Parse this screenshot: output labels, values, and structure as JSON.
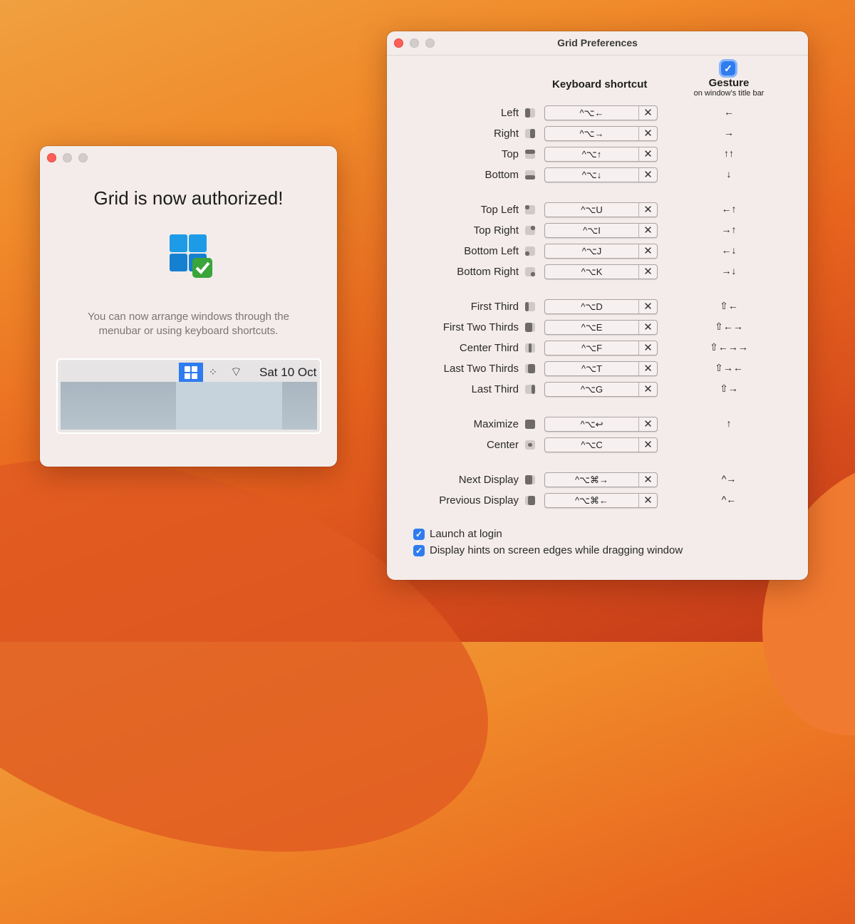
{
  "auth_window": {
    "title": "Grid is now authorized!",
    "description_line1": "You can now arrange windows through the",
    "description_line2": "menubar or using keyboard shortcuts.",
    "menubar": {
      "date": "Sat 10 Oct",
      "wifi_icon": "wifi-icon",
      "grid_icon": "grid-icon"
    }
  },
  "prefs_window": {
    "title": "Grid Preferences",
    "header_keyboard": "Keyboard shortcut",
    "header_gesture": "Gesture",
    "header_gesture_sub": "on window's title bar",
    "gesture_enabled": true,
    "clear_label": "✕",
    "groups": [
      [
        {
          "label": "Left",
          "icon": "left-half",
          "shortcut": "^⌥←",
          "gesture": "←"
        },
        {
          "label": "Right",
          "icon": "right-half",
          "shortcut": "^⌥→",
          "gesture": "→"
        },
        {
          "label": "Top",
          "icon": "top-half",
          "shortcut": "^⌥↑",
          "gesture": "↑↑"
        },
        {
          "label": "Bottom",
          "icon": "bottom-half",
          "shortcut": "^⌥↓",
          "gesture": "↓"
        }
      ],
      [
        {
          "label": "Top Left",
          "icon": "top-left",
          "shortcut": "^⌥U",
          "gesture": "←↑"
        },
        {
          "label": "Top Right",
          "icon": "top-right",
          "shortcut": "^⌥I",
          "gesture": "→↑"
        },
        {
          "label": "Bottom Left",
          "icon": "bottom-left",
          "shortcut": "^⌥J",
          "gesture": "←↓"
        },
        {
          "label": "Bottom Right",
          "icon": "bottom-right",
          "shortcut": "^⌥K",
          "gesture": "→↓"
        }
      ],
      [
        {
          "label": "First Third",
          "icon": "first-third",
          "shortcut": "^⌥D",
          "gesture": "⇧←"
        },
        {
          "label": "First Two Thirds",
          "icon": "first-two-thirds",
          "shortcut": "^⌥E",
          "gesture": "⇧←→"
        },
        {
          "label": "Center Third",
          "icon": "center-third",
          "shortcut": "^⌥F",
          "gesture": "⇧←→→"
        },
        {
          "label": "Last Two Thirds",
          "icon": "last-two-thirds",
          "shortcut": "^⌥T",
          "gesture": "⇧→←"
        },
        {
          "label": "Last Third",
          "icon": "last-third",
          "shortcut": "^⌥G",
          "gesture": "⇧→"
        }
      ],
      [
        {
          "label": "Maximize",
          "icon": "maximize",
          "shortcut": "^⌥↩",
          "gesture": "↑"
        },
        {
          "label": "Center",
          "icon": "center",
          "shortcut": "^⌥C",
          "gesture": ""
        }
      ],
      [
        {
          "label": "Next Display",
          "icon": "next-display",
          "shortcut": "^⌥⌘→",
          "gesture": "^→"
        },
        {
          "label": "Previous Display",
          "icon": "previous-display",
          "shortcut": "^⌥⌘←",
          "gesture": "^←"
        }
      ]
    ],
    "options": [
      {
        "label": "Launch at login",
        "checked": true
      },
      {
        "label": "Display hints on screen edges while dragging window",
        "checked": true
      }
    ]
  }
}
